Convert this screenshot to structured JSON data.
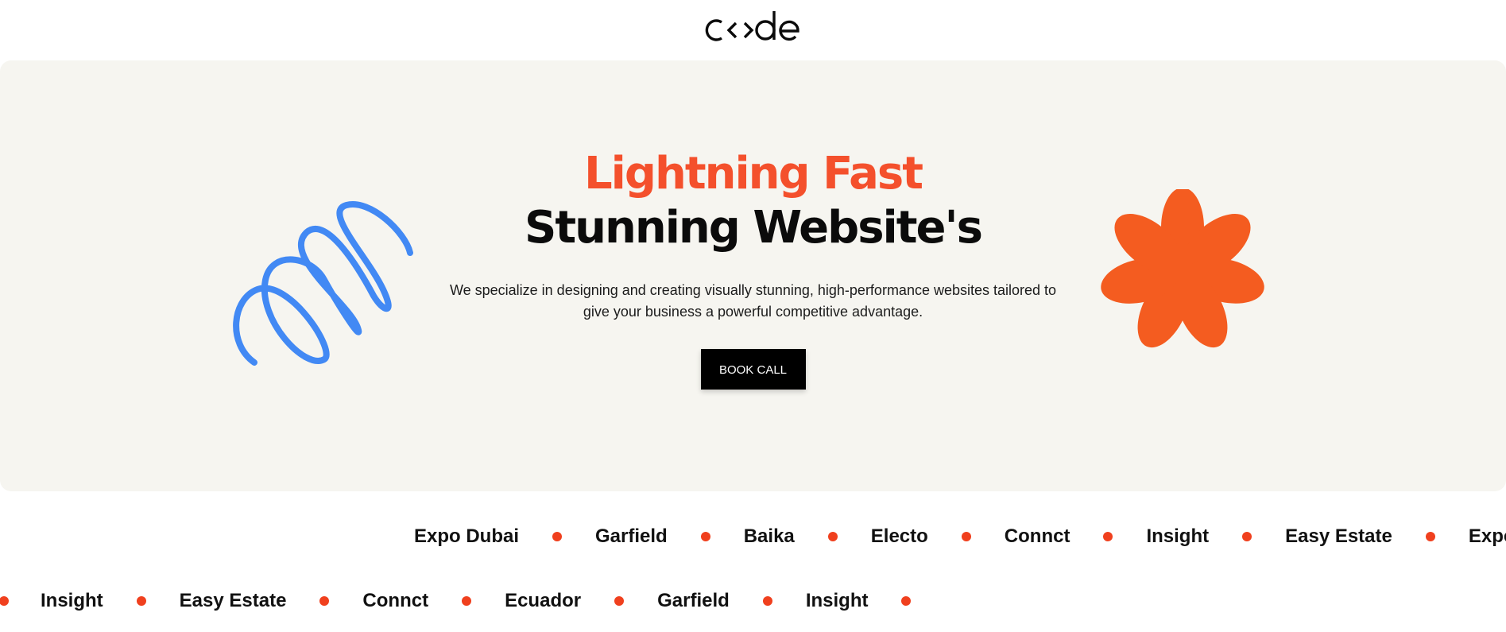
{
  "brand": {
    "logo_text": "c‹›de",
    "logo_label": "code"
  },
  "hero": {
    "heading_accent": "Lightning Fast",
    "heading_main": "Stunning Website's",
    "subtitle": "We specialize in designing and creating visually stunning, high-performance websites tailored to give your business a powerful competitive advantage.",
    "cta_label": "BOOK CALL"
  },
  "colors": {
    "accent": "#f4502c",
    "hero_bg": "#f6f5f0",
    "spring_blue": "#4289f4",
    "flower_orange": "#f45c20",
    "dot_red": "#f0401e"
  },
  "icons": {
    "left_decoration": "blue-spring-icon",
    "right_decoration": "orange-flower-icon",
    "separator": "red-dot-icon"
  },
  "marquee_row1": [
    "Expo Dubai",
    "Garfield",
    "Baika",
    "Electo",
    "Connct",
    "Insight",
    "Easy Estate",
    "Expo"
  ],
  "marquee_row2": [
    "Insight",
    "Easy Estate",
    "Connct",
    "Ecuador",
    "Garfield",
    "Insight"
  ]
}
